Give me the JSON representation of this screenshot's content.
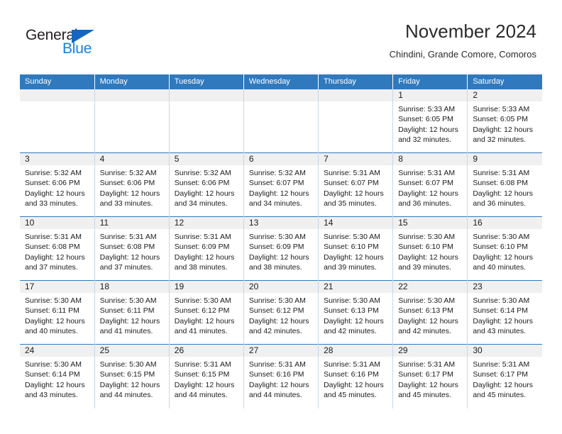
{
  "brand": {
    "name_top": "General",
    "name_bottom": "Blue",
    "triangle_icon": "blue-triangle-icon",
    "colors": {
      "dark": "#231f20",
      "blue": "#1a7fd4",
      "triangle": "#1565c0"
    }
  },
  "header": {
    "title": "November 2024",
    "location": "Chindini, Grande Comore, Comoros"
  },
  "theme": {
    "header_blue": "#3079bd",
    "day_band_gray": "#f0f0f0",
    "grid_line": "#c8d8e8"
  },
  "weekday_headers": [
    "Sunday",
    "Monday",
    "Tuesday",
    "Wednesday",
    "Thursday",
    "Friday",
    "Saturday"
  ],
  "weeks": [
    [
      {
        "date": "",
        "empty": true
      },
      {
        "date": "",
        "empty": true
      },
      {
        "date": "",
        "empty": true
      },
      {
        "date": "",
        "empty": true
      },
      {
        "date": "",
        "empty": true
      },
      {
        "date": "1",
        "sunrise": "Sunrise: 5:33 AM",
        "sunset": "Sunset: 6:05 PM",
        "daylight": "Daylight: 12 hours and 32 minutes."
      },
      {
        "date": "2",
        "sunrise": "Sunrise: 5:33 AM",
        "sunset": "Sunset: 6:05 PM",
        "daylight": "Daylight: 12 hours and 32 minutes."
      }
    ],
    [
      {
        "date": "3",
        "sunrise": "Sunrise: 5:32 AM",
        "sunset": "Sunset: 6:06 PM",
        "daylight": "Daylight: 12 hours and 33 minutes."
      },
      {
        "date": "4",
        "sunrise": "Sunrise: 5:32 AM",
        "sunset": "Sunset: 6:06 PM",
        "daylight": "Daylight: 12 hours and 33 minutes."
      },
      {
        "date": "5",
        "sunrise": "Sunrise: 5:32 AM",
        "sunset": "Sunset: 6:06 PM",
        "daylight": "Daylight: 12 hours and 34 minutes."
      },
      {
        "date": "6",
        "sunrise": "Sunrise: 5:32 AM",
        "sunset": "Sunset: 6:07 PM",
        "daylight": "Daylight: 12 hours and 34 minutes."
      },
      {
        "date": "7",
        "sunrise": "Sunrise: 5:31 AM",
        "sunset": "Sunset: 6:07 PM",
        "daylight": "Daylight: 12 hours and 35 minutes."
      },
      {
        "date": "8",
        "sunrise": "Sunrise: 5:31 AM",
        "sunset": "Sunset: 6:07 PM",
        "daylight": "Daylight: 12 hours and 36 minutes."
      },
      {
        "date": "9",
        "sunrise": "Sunrise: 5:31 AM",
        "sunset": "Sunset: 6:08 PM",
        "daylight": "Daylight: 12 hours and 36 minutes."
      }
    ],
    [
      {
        "date": "10",
        "sunrise": "Sunrise: 5:31 AM",
        "sunset": "Sunset: 6:08 PM",
        "daylight": "Daylight: 12 hours and 37 minutes."
      },
      {
        "date": "11",
        "sunrise": "Sunrise: 5:31 AM",
        "sunset": "Sunset: 6:08 PM",
        "daylight": "Daylight: 12 hours and 37 minutes."
      },
      {
        "date": "12",
        "sunrise": "Sunrise: 5:31 AM",
        "sunset": "Sunset: 6:09 PM",
        "daylight": "Daylight: 12 hours and 38 minutes."
      },
      {
        "date": "13",
        "sunrise": "Sunrise: 5:30 AM",
        "sunset": "Sunset: 6:09 PM",
        "daylight": "Daylight: 12 hours and 38 minutes."
      },
      {
        "date": "14",
        "sunrise": "Sunrise: 5:30 AM",
        "sunset": "Sunset: 6:10 PM",
        "daylight": "Daylight: 12 hours and 39 minutes."
      },
      {
        "date": "15",
        "sunrise": "Sunrise: 5:30 AM",
        "sunset": "Sunset: 6:10 PM",
        "daylight": "Daylight: 12 hours and 39 minutes."
      },
      {
        "date": "16",
        "sunrise": "Sunrise: 5:30 AM",
        "sunset": "Sunset: 6:10 PM",
        "daylight": "Daylight: 12 hours and 40 minutes."
      }
    ],
    [
      {
        "date": "17",
        "sunrise": "Sunrise: 5:30 AM",
        "sunset": "Sunset: 6:11 PM",
        "daylight": "Daylight: 12 hours and 40 minutes."
      },
      {
        "date": "18",
        "sunrise": "Sunrise: 5:30 AM",
        "sunset": "Sunset: 6:11 PM",
        "daylight": "Daylight: 12 hours and 41 minutes."
      },
      {
        "date": "19",
        "sunrise": "Sunrise: 5:30 AM",
        "sunset": "Sunset: 6:12 PM",
        "daylight": "Daylight: 12 hours and 41 minutes."
      },
      {
        "date": "20",
        "sunrise": "Sunrise: 5:30 AM",
        "sunset": "Sunset: 6:12 PM",
        "daylight": "Daylight: 12 hours and 42 minutes."
      },
      {
        "date": "21",
        "sunrise": "Sunrise: 5:30 AM",
        "sunset": "Sunset: 6:13 PM",
        "daylight": "Daylight: 12 hours and 42 minutes."
      },
      {
        "date": "22",
        "sunrise": "Sunrise: 5:30 AM",
        "sunset": "Sunset: 6:13 PM",
        "daylight": "Daylight: 12 hours and 42 minutes."
      },
      {
        "date": "23",
        "sunrise": "Sunrise: 5:30 AM",
        "sunset": "Sunset: 6:14 PM",
        "daylight": "Daylight: 12 hours and 43 minutes."
      }
    ],
    [
      {
        "date": "24",
        "sunrise": "Sunrise: 5:30 AM",
        "sunset": "Sunset: 6:14 PM",
        "daylight": "Daylight: 12 hours and 43 minutes."
      },
      {
        "date": "25",
        "sunrise": "Sunrise: 5:30 AM",
        "sunset": "Sunset: 6:15 PM",
        "daylight": "Daylight: 12 hours and 44 minutes."
      },
      {
        "date": "26",
        "sunrise": "Sunrise: 5:31 AM",
        "sunset": "Sunset: 6:15 PM",
        "daylight": "Daylight: 12 hours and 44 minutes."
      },
      {
        "date": "27",
        "sunrise": "Sunrise: 5:31 AM",
        "sunset": "Sunset: 6:16 PM",
        "daylight": "Daylight: 12 hours and 44 minutes."
      },
      {
        "date": "28",
        "sunrise": "Sunrise: 5:31 AM",
        "sunset": "Sunset: 6:16 PM",
        "daylight": "Daylight: 12 hours and 45 minutes."
      },
      {
        "date": "29",
        "sunrise": "Sunrise: 5:31 AM",
        "sunset": "Sunset: 6:17 PM",
        "daylight": "Daylight: 12 hours and 45 minutes."
      },
      {
        "date": "30",
        "sunrise": "Sunrise: 5:31 AM",
        "sunset": "Sunset: 6:17 PM",
        "daylight": "Daylight: 12 hours and 45 minutes."
      }
    ]
  ]
}
